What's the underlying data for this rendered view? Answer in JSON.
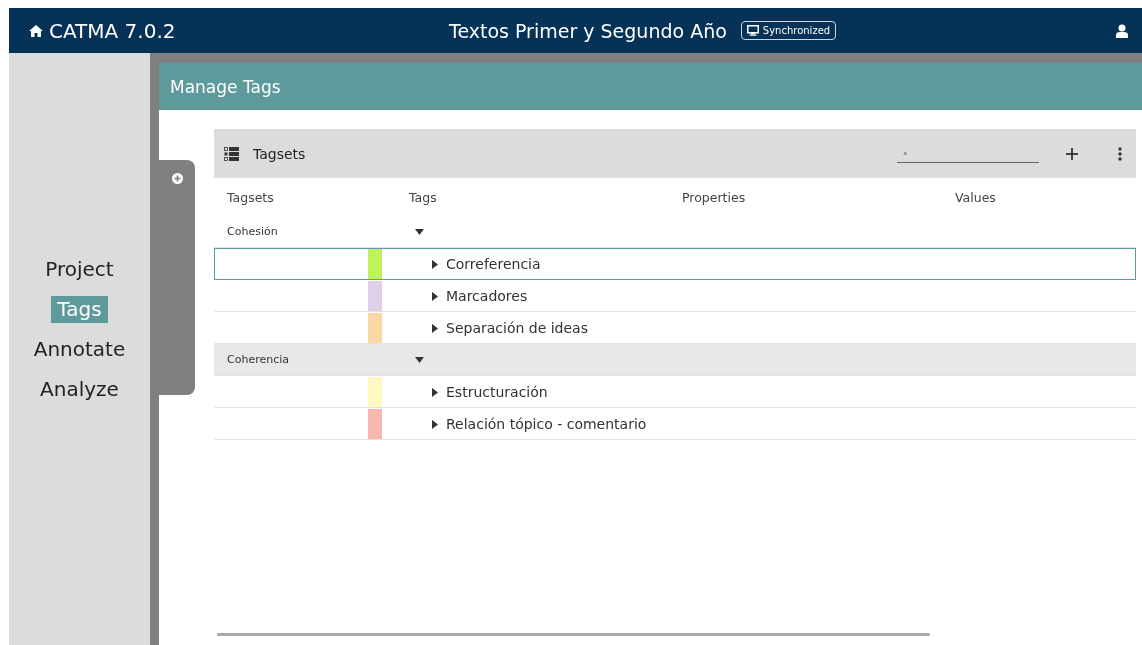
{
  "app": {
    "title": "CATMA 7.0.2"
  },
  "project": {
    "title": "Textos Primer y Segundo Año",
    "sync_status": "Synchronized"
  },
  "nav": [
    {
      "label": "Project",
      "selected": false
    },
    {
      "label": "Tags",
      "selected": true
    },
    {
      "label": "Annotate",
      "selected": false
    },
    {
      "label": "Analyze",
      "selected": false
    }
  ],
  "page_title": "Manage Tags",
  "panel": {
    "title": "Tagsets",
    "search": {
      "placeholder": "⌕"
    },
    "columns": [
      "Tagsets",
      "Tags",
      "Properties",
      "Values"
    ],
    "tagsets": [
      {
        "name": "Cohesión",
        "expanded": true,
        "hovered": false,
        "tags": [
          {
            "name": "Correferencia",
            "color": "#bff35a",
            "expanded": false,
            "selected": true
          },
          {
            "name": "Marcadores",
            "color": "#dfcfe8",
            "expanded": false,
            "selected": false
          },
          {
            "name": "Separación de ideas",
            "color": "#fad8a3",
            "expanded": false,
            "selected": false
          }
        ]
      },
      {
        "name": "Coherencia",
        "expanded": true,
        "hovered": true,
        "tags": [
          {
            "name": "Estructuración",
            "color": "#fff8c0",
            "expanded": false,
            "selected": false
          },
          {
            "name": "Relación tópico - comentario",
            "color": "#f9b7b1",
            "expanded": false,
            "selected": false
          }
        ]
      }
    ]
  }
}
